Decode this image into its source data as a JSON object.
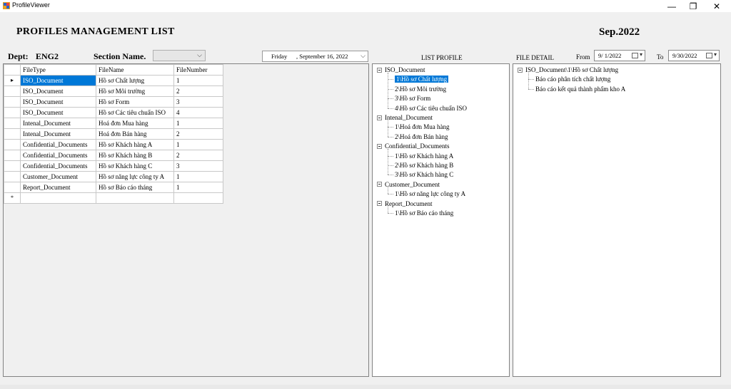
{
  "window": {
    "title": "ProfileViewer",
    "minimize": "—",
    "maximize": "❐",
    "close": "✕"
  },
  "header": {
    "title": "PROFILES MANAGEMENT LIST",
    "month": "Sep.2022"
  },
  "filters": {
    "dept_label": "Dept:",
    "dept_value": "ENG2",
    "section_label": "Section Name.",
    "section_value": "",
    "date_day": "Friday",
    "date_rest": ", September 16, 2022"
  },
  "list_profile_label": "LIST PROFILE",
  "file_detail": {
    "label": "FILE DETAIL",
    "from_label": "From",
    "from_value": "9/ 1/2022",
    "to_label": "To",
    "to_value": "9/30/2022"
  },
  "grid": {
    "columns": [
      "FileType",
      "FileName",
      "FileNumber"
    ],
    "rows": [
      [
        "ISO_Document",
        "Hồ sơ Chất lượng",
        "1"
      ],
      [
        "ISO_Document",
        "Hồ sơ Môi trường",
        "2"
      ],
      [
        "ISO_Document",
        "Hồ sơ Form",
        "3"
      ],
      [
        "ISO_Document",
        "Hồ sơ Các tiêu chuẩn ISO",
        "4"
      ],
      [
        "Intenal_Document",
        "Hoá đơn Mua hàng",
        "1"
      ],
      [
        "Intenal_Document",
        "Hoá đơn Bán hàng",
        "2"
      ],
      [
        "Confidential_Documents",
        "Hồ sơ Khách hàng A",
        "1"
      ],
      [
        "Confidential_Documents",
        "Hồ sơ Khách hàng B",
        "2"
      ],
      [
        "Confidential_Documents",
        "Hồ sơ Khách hàng C",
        "3"
      ],
      [
        "Customer_Document",
        "Hồ sơ năng lực công ty A",
        "1"
      ],
      [
        "Report_Document",
        "Hồ sơ Báo cáo tháng",
        "1"
      ]
    ],
    "current_row_marker": "▸",
    "new_row_marker": "*"
  },
  "list_tree": [
    {
      "label": "ISO_Document",
      "children": [
        "1\\Hồ sơ Chất lượng",
        "2\\Hồ sơ Môi trường",
        "3\\Hồ sơ Form",
        "4\\Hồ sơ Các tiêu chuẩn ISO"
      ]
    },
    {
      "label": "Intenal_Document",
      "children": [
        "1\\Hoá đơn Mua hàng",
        "2\\Hoá đơn Bán hàng"
      ]
    },
    {
      "label": "Confidential_Documents",
      "children": [
        "1\\Hồ sơ Khách hàng A",
        "2\\Hồ sơ Khách hàng B",
        "3\\Hồ sơ Khách hàng C"
      ]
    },
    {
      "label": "Customer_Document",
      "children": [
        "1\\Hồ sơ năng lực công ty A"
      ]
    },
    {
      "label": "Report_Document",
      "children": [
        "1\\Hồ sơ Báo cáo tháng"
      ]
    }
  ],
  "detail_tree": {
    "label": "ISO_Document\\1\\Hồ sơ Chất lượng",
    "children": [
      "Báo cáo phân tích chất lượng",
      "Báo cáo kết quả thành phẩm kho A"
    ]
  },
  "colors": {
    "selection": "#0078d7",
    "background": "#f0f0f0"
  }
}
